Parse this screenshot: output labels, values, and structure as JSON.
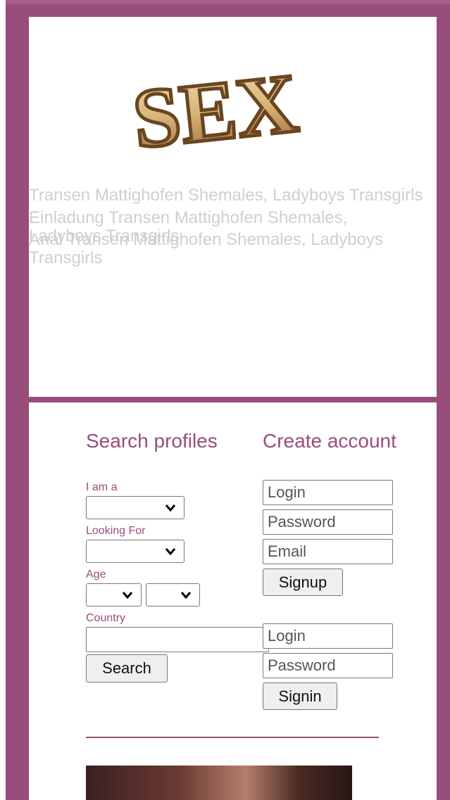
{
  "colors": {
    "frame": "#974e7a",
    "accent": "#974e7a"
  },
  "logo": {
    "text": "SEX",
    "icon": "sex-logo-icon"
  },
  "headlines": [
    "Transen Mattighofen Shemales, Ladyboys Transgirls",
    "Einladung Transen Mattighofen Shemales, Ladyboys Transgirls",
    "Anal Transen Mattighofen Shemales, Ladyboys Transgirls"
  ],
  "search": {
    "heading": "Search profiles",
    "i_am_label": "I am a",
    "looking_for_label": "Looking For",
    "age_label": "Age",
    "country_label": "Country",
    "country_value": "",
    "search_button": "Search"
  },
  "create": {
    "heading": "Create account",
    "login_placeholder": "Login",
    "password_placeholder": "Password",
    "email_placeholder": "Email",
    "signup_button": "Signup"
  },
  "signin": {
    "login_placeholder": "Login",
    "password_placeholder": "Password",
    "signin_button": "Signin"
  }
}
